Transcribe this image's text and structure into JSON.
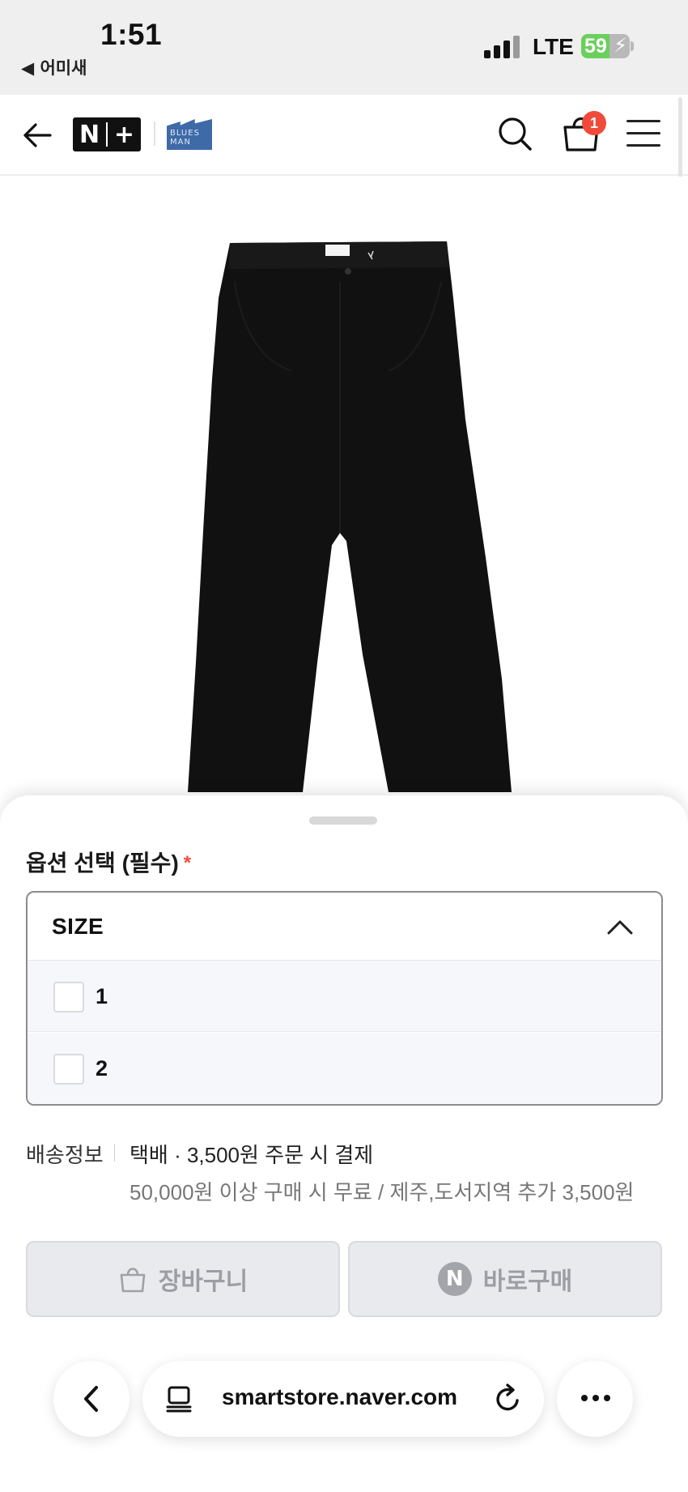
{
  "status_bar": {
    "time": "1:51",
    "back_app": "◀ 어미새",
    "network": "LTE",
    "battery": "59",
    "battery_level": 0.59
  },
  "header": {
    "nplus_letters": [
      "N",
      "+"
    ],
    "brand_lines": [
      "BLUES",
      "MAN"
    ],
    "cart_count": "1"
  },
  "option_sheet": {
    "title": "옵션 선택 (필수)",
    "required_mark": "*",
    "select_label": "SIZE",
    "options": [
      "1",
      "2"
    ]
  },
  "shipping": {
    "label": "배송정보",
    "main": "택배 · 3,500원 주문 시 결제",
    "sub": "50,000원 이상 구매 시 무료 / 제주,도서지역 추가 3,500원"
  },
  "buttons": {
    "cart": "장바구니",
    "buy_badge": "N",
    "buy": "바로구매"
  },
  "browser": {
    "url": "smartstore.naver.com"
  },
  "colors": {
    "badge_red": "#f04b3a",
    "battery_green": "#6ad05c",
    "disabled_btn_bg": "#e9eaed",
    "option_row_bg": "#f6f7fb"
  }
}
